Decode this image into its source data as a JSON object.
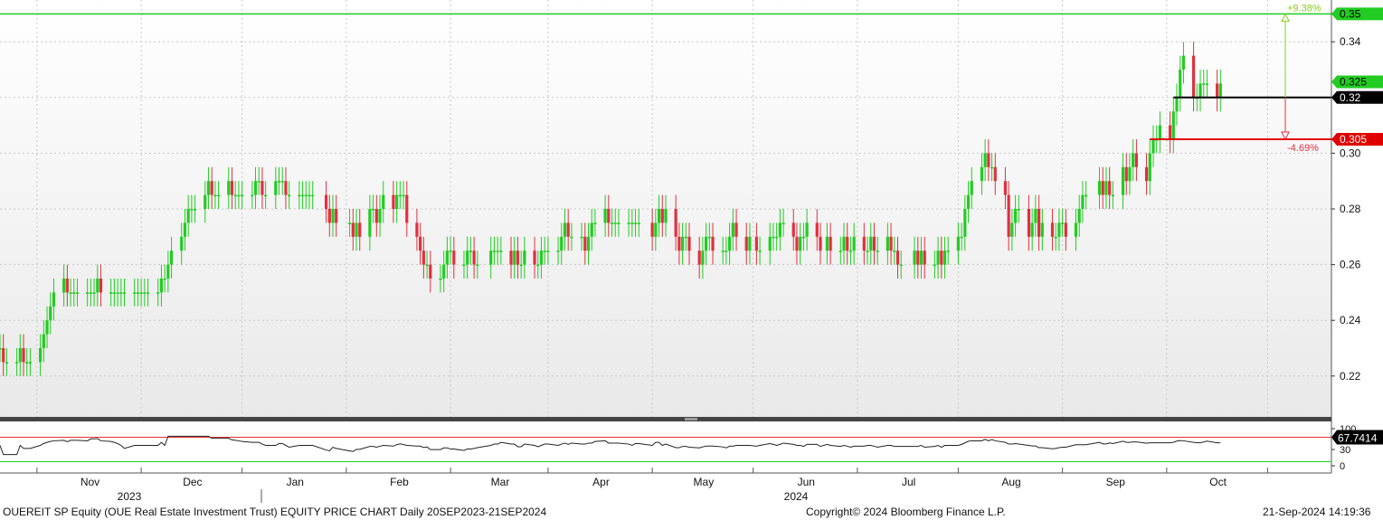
{
  "chart_data": {
    "type": "candlestick",
    "security": "OUEREIT SP Equity",
    "y_range": [
      0.205,
      0.355
    ],
    "y_ticks": [
      "0.22",
      "0.24",
      "0.26",
      "0.28",
      "0.30",
      "0.34"
    ],
    "x_months": [
      "Nov",
      "Dec",
      "Jan",
      "Feb",
      "Mar",
      "Apr",
      "May",
      "Jun",
      "Jul",
      "Aug",
      "Sep",
      "Oct"
    ],
    "x_years": [
      "2023",
      "2024"
    ],
    "series": [
      {
        "dates": [
          "2023-09-20",
          "2023-09-21",
          "2023-09-22",
          "2023-09-25",
          "2023-09-26",
          "2023-09-27",
          "2023-09-28",
          "2023-09-29",
          "2023-10-02",
          "2023-10-03",
          "2023-10-04",
          "2023-10-05",
          "2023-10-06",
          "2023-10-09",
          "2023-10-10",
          "2023-10-11",
          "2023-10-12",
          "2023-10-13",
          "2023-10-16",
          "2023-10-17",
          "2023-10-18",
          "2023-10-19",
          "2023-10-20",
          "2023-10-23",
          "2023-10-24",
          "2023-10-25",
          "2023-10-26",
          "2023-10-27",
          "2023-10-30",
          "2023-10-31",
          "2023-11-01",
          "2023-11-02",
          "2023-11-03",
          "2023-11-06",
          "2023-11-07",
          "2023-11-08",
          "2023-11-09",
          "2023-11-10",
          "2023-11-13",
          "2023-11-14",
          "2023-11-15",
          "2023-11-16",
          "2023-11-17",
          "2023-11-20",
          "2023-11-21",
          "2023-11-22",
          "2023-11-23",
          "2023-11-24",
          "2023-11-27",
          "2023-11-28",
          "2023-11-29",
          "2023-11-30",
          "2023-12-01",
          "2023-12-04",
          "2023-12-05",
          "2023-12-06",
          "2023-12-07",
          "2023-12-08",
          "2023-12-11",
          "2023-12-12",
          "2023-12-13",
          "2023-12-14",
          "2023-12-15",
          "2023-12-18",
          "2023-12-19",
          "2023-12-20",
          "2023-12-21",
          "2023-12-22",
          "2023-12-26",
          "2023-12-27",
          "2023-12-28",
          "2023-12-29",
          "2024-01-02",
          "2024-01-03",
          "2024-01-04",
          "2024-01-05",
          "2024-01-08",
          "2024-01-09",
          "2024-01-10",
          "2024-01-11",
          "2024-01-12",
          "2024-01-15",
          "2024-01-16",
          "2024-01-17",
          "2024-01-18",
          "2024-01-19",
          "2024-01-22",
          "2024-01-23",
          "2024-01-24",
          "2024-01-25",
          "2024-01-26",
          "2024-01-29",
          "2024-01-30",
          "2024-01-31",
          "2024-02-01",
          "2024-02-02",
          "2024-02-05",
          "2024-02-06",
          "2024-02-07",
          "2024-02-08",
          "2024-02-09",
          "2024-02-13",
          "2024-02-14",
          "2024-02-15",
          "2024-02-16",
          "2024-02-19",
          "2024-02-20",
          "2024-02-21",
          "2024-02-22",
          "2024-02-23",
          "2024-02-26",
          "2024-02-27",
          "2024-02-28",
          "2024-02-29",
          "2024-03-01",
          "2024-03-04",
          "2024-03-05",
          "2024-03-06",
          "2024-03-07",
          "2024-03-08",
          "2024-03-11",
          "2024-03-12",
          "2024-03-13",
          "2024-03-14",
          "2024-03-15",
          "2024-03-18",
          "2024-03-19",
          "2024-03-20",
          "2024-03-21",
          "2024-03-22",
          "2024-03-25",
          "2024-03-26",
          "2024-03-27",
          "2024-03-28",
          "2024-04-01",
          "2024-04-02",
          "2024-04-03",
          "2024-04-04",
          "2024-04-05",
          "2024-04-08",
          "2024-04-09",
          "2024-04-10",
          "2024-04-11",
          "2024-04-12",
          "2024-04-15",
          "2024-04-16",
          "2024-04-17",
          "2024-04-18",
          "2024-04-19",
          "2024-04-22",
          "2024-04-23",
          "2024-04-24",
          "2024-04-25",
          "2024-04-26",
          "2024-04-29",
          "2024-04-30",
          "2024-05-02",
          "2024-05-03",
          "2024-05-06",
          "2024-05-07",
          "2024-05-08",
          "2024-05-09",
          "2024-05-10",
          "2024-05-13",
          "2024-05-14",
          "2024-05-15",
          "2024-05-16",
          "2024-05-17",
          "2024-05-20",
          "2024-05-21",
          "2024-05-23",
          "2024-05-24",
          "2024-05-27",
          "2024-05-28",
          "2024-05-29",
          "2024-05-30",
          "2024-05-31",
          "2024-06-03",
          "2024-06-04",
          "2024-06-05",
          "2024-06-06",
          "2024-06-07",
          "2024-06-10",
          "2024-06-11",
          "2024-06-12",
          "2024-06-13",
          "2024-06-14",
          "2024-06-18",
          "2024-06-19",
          "2024-06-20",
          "2024-06-21",
          "2024-06-24",
          "2024-06-25",
          "2024-06-26",
          "2024-06-27",
          "2024-06-28",
          "2024-07-01",
          "2024-07-02",
          "2024-07-03",
          "2024-07-04",
          "2024-07-05",
          "2024-07-08",
          "2024-07-09",
          "2024-07-10",
          "2024-07-11",
          "2024-07-12",
          "2024-07-15",
          "2024-07-16",
          "2024-07-17",
          "2024-07-18",
          "2024-07-19",
          "2024-07-22",
          "2024-07-23",
          "2024-07-24",
          "2024-07-25",
          "2024-07-26",
          "2024-07-29",
          "2024-07-30",
          "2024-07-31",
          "2024-08-01",
          "2024-08-02",
          "2024-08-05",
          "2024-08-06",
          "2024-08-07",
          "2024-08-08",
          "2024-08-12",
          "2024-08-13",
          "2024-08-14",
          "2024-08-15",
          "2024-08-16",
          "2024-08-19",
          "2024-08-20",
          "2024-08-21",
          "2024-08-22",
          "2024-08-23",
          "2024-08-26",
          "2024-08-27",
          "2024-08-28",
          "2024-08-29",
          "2024-08-30",
          "2024-09-02",
          "2024-09-03",
          "2024-09-04",
          "2024-09-05",
          "2024-09-06",
          "2024-09-09",
          "2024-09-10",
          "2024-09-11",
          "2024-09-12",
          "2024-09-13",
          "2024-09-16",
          "2024-09-17",
          "2024-09-18",
          "2024-09-19",
          "2024-09-20"
        ],
        "close": [
          0.23,
          0.225,
          0.225,
          0.225,
          0.23,
          0.225,
          0.225,
          0.225,
          0.23,
          0.235,
          0.24,
          0.245,
          0.25,
          0.255,
          0.25,
          0.25,
          0.25,
          0.25,
          0.25,
          0.25,
          0.25,
          0.255,
          0.25,
          0.25,
          0.25,
          0.25,
          0.25,
          0.25,
          0.25,
          0.25,
          0.25,
          0.25,
          0.25,
          0.25,
          0.255,
          0.255,
          0.26,
          0.265,
          0.27,
          0.275,
          0.28,
          0.28,
          0.28,
          0.285,
          0.29,
          0.285,
          0.285,
          0.285,
          0.29,
          0.285,
          0.285,
          0.285,
          0.285,
          0.285,
          0.29,
          0.29,
          0.285,
          0.285,
          0.29,
          0.29,
          0.29,
          0.285,
          0.285,
          0.285,
          0.285,
          0.285,
          0.285,
          0.285,
          0.28,
          0.275,
          0.28,
          0.275,
          0.275,
          0.27,
          0.275,
          0.27,
          0.28,
          0.28,
          0.275,
          0.28,
          0.285,
          0.28,
          0.285,
          0.285,
          0.285,
          0.275,
          0.27,
          0.265,
          0.26,
          0.26,
          0.255,
          0.255,
          0.26,
          0.265,
          0.265,
          0.26,
          0.26,
          0.265,
          0.265,
          0.26,
          0.26,
          0.265,
          0.265,
          0.265,
          0.265,
          0.26,
          0.265,
          0.26,
          0.26,
          0.265,
          0.26,
          0.26,
          0.265,
          0.265,
          0.265,
          0.265,
          0.27,
          0.275,
          0.27,
          0.27,
          0.27,
          0.265,
          0.27,
          0.275,
          0.275,
          0.28,
          0.275,
          0.275,
          0.275,
          0.275,
          0.275,
          0.275,
          0.275,
          0.275,
          0.27,
          0.275,
          0.28,
          0.275,
          0.28,
          0.27,
          0.265,
          0.27,
          0.27,
          0.265,
          0.26,
          0.265,
          0.27,
          0.27,
          0.265,
          0.265,
          0.265,
          0.27,
          0.275,
          0.27,
          0.265,
          0.27,
          0.265,
          0.265,
          0.27,
          0.27,
          0.27,
          0.275,
          0.275,
          0.27,
          0.265,
          0.27,
          0.27,
          0.275,
          0.27,
          0.265,
          0.27,
          0.265,
          0.265,
          0.27,
          0.265,
          0.265,
          0.27,
          0.265,
          0.265,
          0.27,
          0.265,
          0.265,
          0.27,
          0.265,
          0.265,
          0.26,
          0.26,
          0.265,
          0.26,
          0.265,
          0.26,
          0.26,
          0.265,
          0.26,
          0.265,
          0.265,
          0.27,
          0.27,
          0.28,
          0.285,
          0.29,
          0.295,
          0.3,
          0.295,
          0.295,
          0.29,
          0.285,
          0.27,
          0.275,
          0.28,
          0.28,
          0.27,
          0.275,
          0.28,
          0.27,
          0.275,
          0.27,
          0.27,
          0.275,
          0.275,
          0.27,
          0.275,
          0.28,
          0.285,
          0.285,
          0.29,
          0.285,
          0.29,
          0.285,
          0.285,
          0.295,
          0.29,
          0.295,
          0.3,
          0.295,
          0.29,
          0.3,
          0.305,
          0.305,
          0.31,
          0.305,
          0.315,
          0.32,
          0.33,
          0.335,
          0.32,
          0.32,
          0.325,
          0.325,
          0.325,
          0.32,
          0.325
        ],
        "name": "OUEREIT SP Equity"
      }
    ],
    "rsi": {
      "levels": [
        70,
        30
      ],
      "ticks": [
        "100",
        "30",
        "0"
      ],
      "last": "67.7414"
    },
    "last_price": "0.32",
    "levels": [
      {
        "value": 0.35,
        "label": "0.35",
        "color": "#22cc22"
      },
      {
        "value": 0.305,
        "label": "0.305",
        "color": "#e00000"
      },
      {
        "value": 0.325,
        "label": "0.325",
        "color": "#22cc22"
      },
      {
        "value": 0.32,
        "label": "0.32",
        "color": "#000000"
      }
    ],
    "annotations": {
      "upper_pct": "+9.38%",
      "lower_pct": "-4.69%"
    },
    "colors": {
      "up": "#22cc22",
      "down": "#e03040",
      "grid": "#cccccc"
    }
  },
  "footer": {
    "left": "OUEREIT SP Equity (OUE Real Estate Investment Trust) EQUITY PRICE CHART  Daily 20SEP2023-21SEP2024",
    "center": "Copyright© 2024 Bloomberg Finance L.P.",
    "right": "21-Sep-2024 14:19:36"
  }
}
